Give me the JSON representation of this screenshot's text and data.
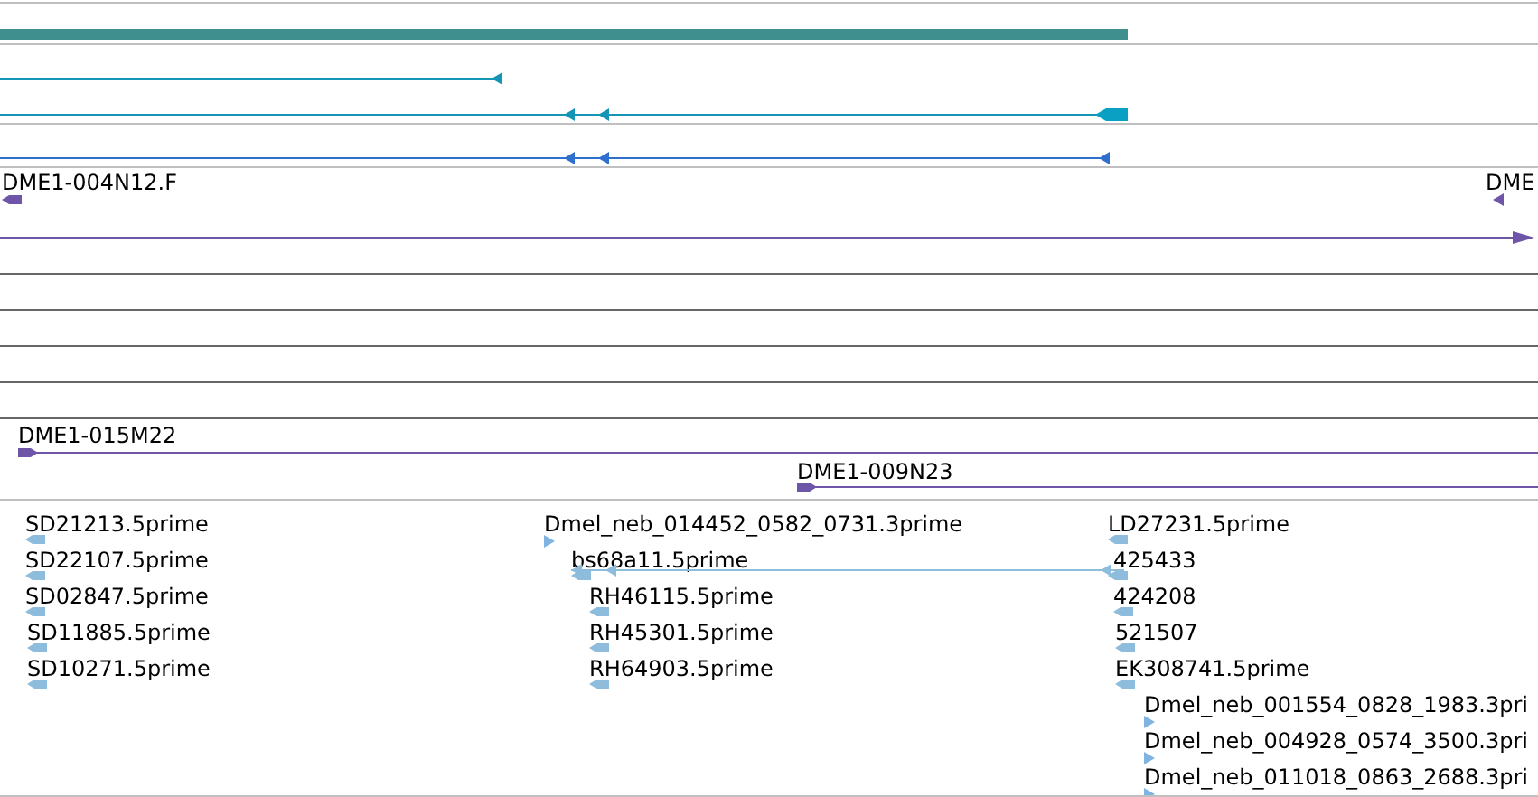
{
  "clone_track": {
    "features": [
      {
        "label": "DME1-004N12.F",
        "reverse_strand": true
      },
      {
        "label": "DME",
        "reverse_strand": true
      },
      {
        "label": "DME1-015M22",
        "reverse_strand": false
      },
      {
        "label": "DME1-009N23",
        "reverse_strand": false
      }
    ]
  },
  "read_track": {
    "features": [
      {
        "label": "SD21213.5prime",
        "reverse_strand": true
      },
      {
        "label": "SD22107.5prime",
        "reverse_strand": true
      },
      {
        "label": "SD02847.5prime",
        "reverse_strand": true
      },
      {
        "label": "SD11885.5prime",
        "reverse_strand": true
      },
      {
        "label": "SD10271.5prime",
        "reverse_strand": true
      },
      {
        "label": "Dmel_neb_014452_0582_0731.3prime",
        "reverse_strand": false
      },
      {
        "label": "bs68a11.5prime",
        "reverse_strand": true
      },
      {
        "label": "RH46115.5prime",
        "reverse_strand": true
      },
      {
        "label": "RH45301.5prime",
        "reverse_strand": true
      },
      {
        "label": "RH64903.5prime",
        "reverse_strand": true
      },
      {
        "label": "LD27231.5prime",
        "reverse_strand": true
      },
      {
        "label": "425433",
        "reverse_strand": true
      },
      {
        "label": "424208",
        "reverse_strand": true
      },
      {
        "label": "521507",
        "reverse_strand": true
      },
      {
        "label": "EK308741.5prime",
        "reverse_strand": true
      },
      {
        "label": "Dmel_neb_001554_0828_1983.3pri",
        "reverse_strand": false
      },
      {
        "label": "Dmel_neb_004928_0574_3500.3pri",
        "reverse_strand": false
      },
      {
        "label": "Dmel_neb_011018_0863_2688.3pri",
        "reverse_strand": false
      }
    ]
  }
}
